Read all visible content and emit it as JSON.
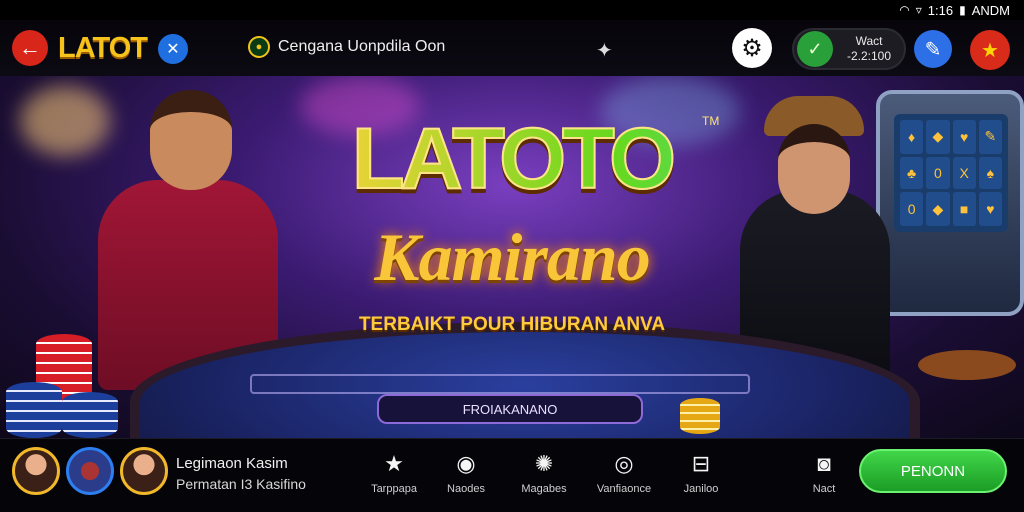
{
  "status_bar": {
    "time": "1:16",
    "carrier": "ANDM",
    "icons": [
      "wifi-icon",
      "location-icon",
      "battery-icon"
    ]
  },
  "header": {
    "logo_text": "LATOT",
    "promo_text": "Cengana Uonpdila Oon",
    "wallet": {
      "label": "Wact",
      "amount": "-2.2:100"
    }
  },
  "hero": {
    "title_line1": "LATOTO",
    "trademark": "TM",
    "title_line2": "Kamirano",
    "tagline": "TERBAIKT POUR HIBURAN ANVA",
    "table_label": "FROIAKANANO",
    "slot_symbols": [
      "♦",
      "◆",
      "♥",
      "✎",
      "♣",
      "0",
      "X",
      "♠",
      "0",
      "◆",
      "■",
      "♥"
    ]
  },
  "footer": {
    "user_name": "Legimaon Kasim",
    "user_subtitle": "Permatan I3 Kasifino",
    "nav": [
      {
        "label": "Tarppapa",
        "icon": "star-icon"
      },
      {
        "label": "Naodes",
        "icon": "chip-icon"
      },
      {
        "label": "Magabes",
        "icon": "gear-badge-icon"
      },
      {
        "label": "Vanfiaonce",
        "icon": "coin-icon"
      },
      {
        "label": "Janiloo",
        "icon": "bed-icon"
      },
      {
        "label": "Nact",
        "icon": "camera-icon"
      }
    ],
    "cta_label": "PENONN"
  },
  "colors": {
    "accent": "#f6c21c",
    "brand_red": "#d8261b",
    "cta_green": "#2ab633",
    "banner_purple": "#3b1b72"
  }
}
